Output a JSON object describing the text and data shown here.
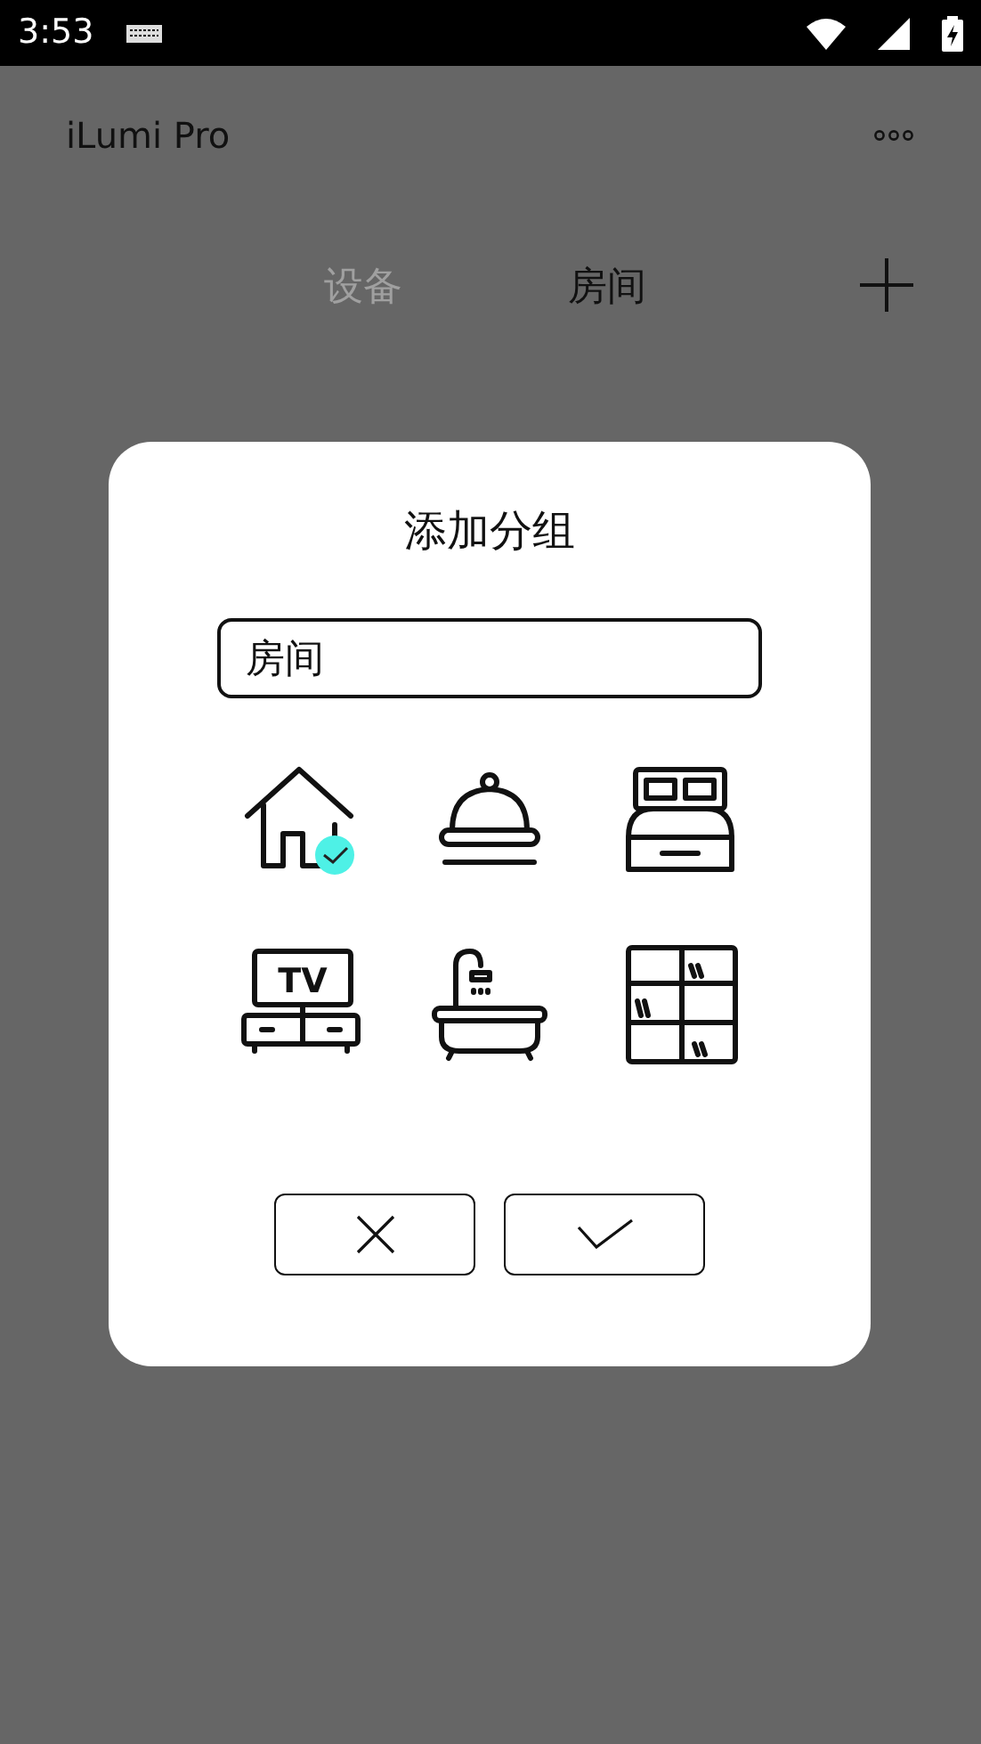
{
  "status_bar": {
    "time": "3:53"
  },
  "app_bar": {
    "title": "iLumi Pro"
  },
  "tabs": [
    {
      "label": "设备",
      "selected": false
    },
    {
      "label": "房间",
      "selected": true
    }
  ],
  "dialog": {
    "title": "添加分组",
    "field": {
      "value": "房间"
    },
    "icons": [
      {
        "kind": "house",
        "selected": true
      },
      {
        "kind": "cloche",
        "selected": false
      },
      {
        "kind": "bed",
        "selected": false
      },
      {
        "kind": "tv",
        "selected": false,
        "label": "TV"
      },
      {
        "kind": "bathtub",
        "selected": false
      },
      {
        "kind": "shelf",
        "selected": false
      }
    ]
  }
}
